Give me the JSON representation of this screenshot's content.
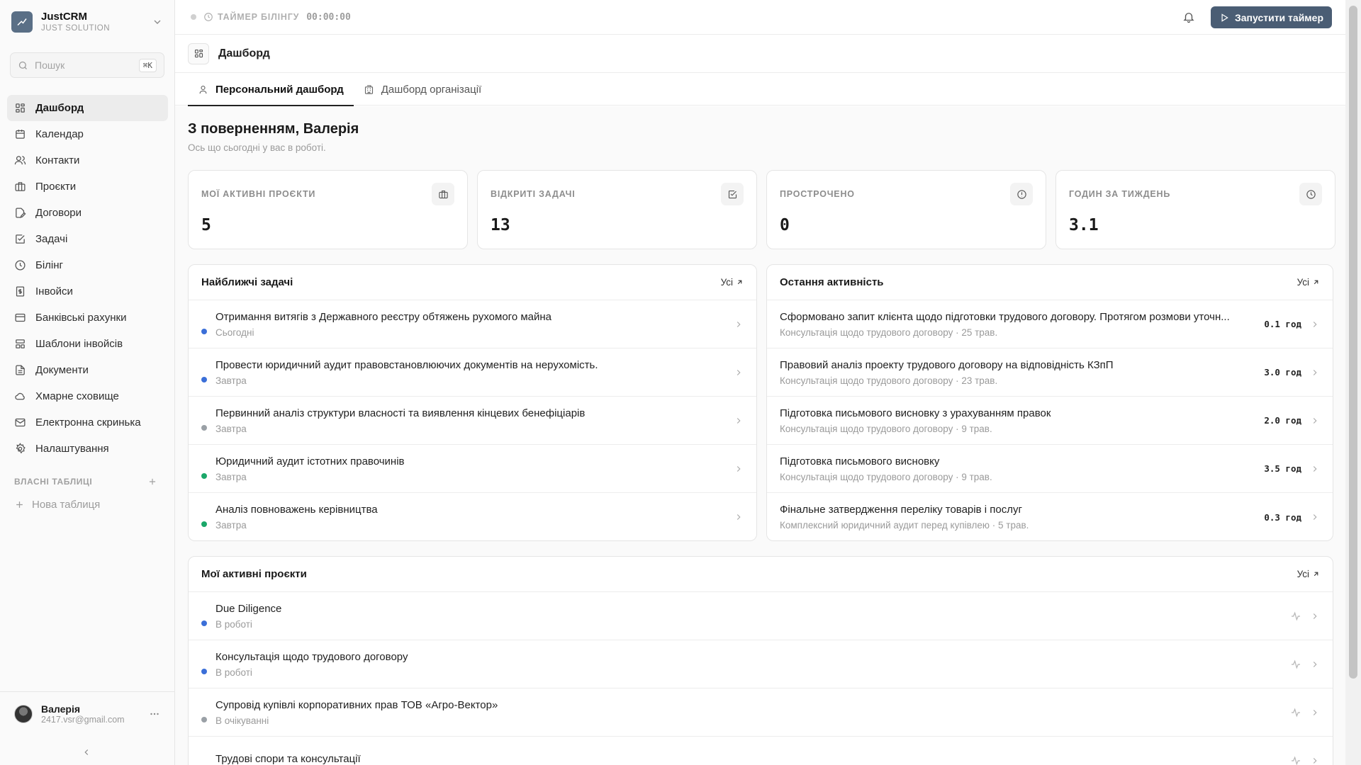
{
  "sidebar": {
    "brand": {
      "name": "JustCRM",
      "sub": "JUST SOLUTION"
    },
    "search": {
      "placeholder": "Пошук",
      "shortcut": "⌘K"
    },
    "nav": [
      {
        "label": "Дашборд",
        "icon": "dashboard-icon",
        "active": true
      },
      {
        "label": "Календар",
        "icon": "calendar-icon"
      },
      {
        "label": "Контакти",
        "icon": "contacts-icon"
      },
      {
        "label": "Проєкти",
        "icon": "briefcase-icon"
      },
      {
        "label": "Договори",
        "icon": "contract-icon"
      },
      {
        "label": "Задачі",
        "icon": "task-icon"
      },
      {
        "label": "Білінг",
        "icon": "clock-icon"
      },
      {
        "label": "Інвойси",
        "icon": "invoice-icon"
      },
      {
        "label": "Банківські рахунки",
        "icon": "bank-card-icon"
      },
      {
        "label": "Шаблони інвойсів",
        "icon": "template-icon"
      },
      {
        "label": "Документи",
        "icon": "document-icon"
      },
      {
        "label": "Хмарне сховище",
        "icon": "cloud-icon"
      },
      {
        "label": "Електронна скринька",
        "icon": "mail-icon"
      },
      {
        "label": "Налаштування",
        "icon": "gear-icon"
      }
    ],
    "custom_tables": {
      "title": "ВЛАСНІ ТАБЛИЦІ",
      "new_label": "Нова таблиця"
    },
    "user": {
      "name": "Валерія",
      "email": "2417.vsr@gmail.com"
    }
  },
  "topbar": {
    "timer_label": "ТАЙМЕР БІЛІНГУ",
    "timer_value": "00:00:00",
    "start_label": "Запустити таймер",
    "accent": "#4a5d74"
  },
  "page": {
    "title": "Дашборд",
    "tabs": [
      {
        "label": "Персональний дашборд",
        "icon": "user-icon",
        "active": true
      },
      {
        "label": "Дашборд організації",
        "icon": "building-icon"
      }
    ],
    "greeting": "З поверненням, Валерія",
    "greeting_sub": "Ось що сьогодні у вас в роботі."
  },
  "stats": [
    {
      "label": "МОЇ АКТИВНІ ПРОЄКТИ",
      "value": "5",
      "icon": "briefcase-icon"
    },
    {
      "label": "ВІДКРИТІ ЗАДАЧІ",
      "value": "13",
      "icon": "task-icon"
    },
    {
      "label": "ПРОСТРОЧЕНО",
      "value": "0",
      "icon": "alert-icon"
    },
    {
      "label": "ГОДИН ЗА ТИЖДЕНЬ",
      "value": "3.1",
      "icon": "clock-icon"
    }
  ],
  "tasks_card": {
    "title": "Найближчі задачі",
    "all_label": "Усі",
    "items": [
      {
        "title": "Отримання витягів з Державного реєстру обтяжень рухомого майна",
        "due": "Сьогодні",
        "color": "#3b6fd8"
      },
      {
        "title": "Провести юридичний аудит правовстановлюючих документів на нерухомість.",
        "due": "Завтра",
        "color": "#3b6fd8"
      },
      {
        "title": "Первинний аналіз структури власності та виявлення кінцевих бенефіціарів",
        "due": "Завтра",
        "color": "#9aa0a6"
      },
      {
        "title": "Юридичний аудит істотних правочинів",
        "due": "Завтра",
        "color": "#1aa769"
      },
      {
        "title": "Аналіз повноважень керівництва",
        "due": "Завтра",
        "color": "#1aa769"
      }
    ]
  },
  "activity_card": {
    "title": "Остання активність",
    "all_label": "Усі",
    "items": [
      {
        "title": "Сформовано запит клієнта щодо підготовки трудового договору. Протягом розмови уточн...",
        "sub": "Консультація щодо трудового договору · 25 трав.",
        "hours": "0.1 год"
      },
      {
        "title": "Правовий аналіз проекту трудового договору на відповідність КЗпП",
        "sub": "Консультація щодо трудового договору · 23 трав.",
        "hours": "3.0 год"
      },
      {
        "title": "Підготовка письмового висновку з урахуванням правок",
        "sub": "Консультація щодо трудового договору · 9 трав.",
        "hours": "2.0 год"
      },
      {
        "title": "Підготовка письмового висновку",
        "sub": "Консультація щодо трудового договору · 9 трав.",
        "hours": "3.5 год"
      },
      {
        "title": "Фінальне затвердження переліку товарів і послуг",
        "sub": "Комплексний юридичний аудит перед купівлею · 5 трав.",
        "hours": "0.3 год"
      }
    ]
  },
  "projects_card": {
    "title": "Мої активні проєкти",
    "all_label": "Усі",
    "items": [
      {
        "title": "Due Diligence",
        "status": "В роботі",
        "color": "#3b6fd8"
      },
      {
        "title": "Консультація щодо трудового договору",
        "status": "В роботі",
        "color": "#3b6fd8"
      },
      {
        "title": "Супровід купівлі корпоративних прав ТОВ «Агро-Вектор»",
        "status": "В очікуванні",
        "color": "#9aa0a6"
      },
      {
        "title": "Трудові спори та консультації",
        "status": "",
        "color": "#1aa769"
      }
    ]
  }
}
